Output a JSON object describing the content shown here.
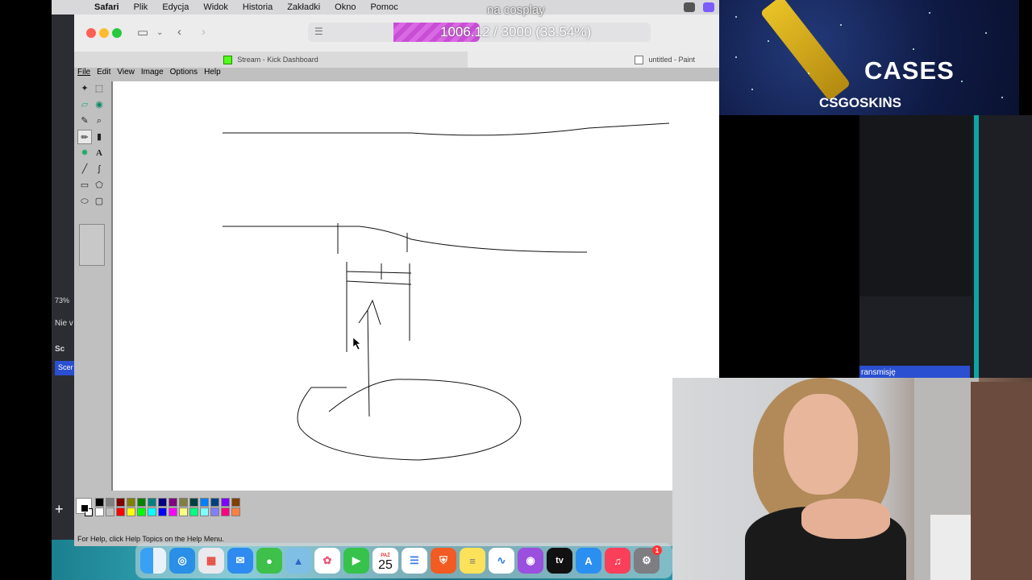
{
  "menubar": {
    "app": "Safari",
    "items": [
      "Plik",
      "Edycja",
      "Widok",
      "Historia",
      "Zakładki",
      "Okno",
      "Pomoc"
    ]
  },
  "overlay_caption": "na cosplay",
  "progress": {
    "text": "1006.12 / 3000 (33.54%)",
    "fraction": 0.3354
  },
  "tabs": [
    {
      "label": "Stream - Kick Dashboard",
      "icon": "kick-logo-icon"
    },
    {
      "label": "untitled - Paint",
      "icon": "paint-icon"
    }
  ],
  "paint": {
    "menu": [
      "File",
      "Edit",
      "View",
      "Image",
      "Options",
      "Help"
    ],
    "status": "For Help, click Help Topics on the Help Menu.",
    "palette": [
      "#000000",
      "#808080",
      "#800000",
      "#808000",
      "#008000",
      "#008080",
      "#000080",
      "#800080",
      "#808040",
      "#004040",
      "#0080ff",
      "#004080",
      "#8000ff",
      "#804000",
      "#ffffff",
      "#c0c0c0",
      "#ff0000",
      "#ffff00",
      "#00ff00",
      "#00ffff",
      "#0000ff",
      "#ff00ff",
      "#ffff80",
      "#00ff80",
      "#80ffff",
      "#8080ff",
      "#ff0080",
      "#ff8040"
    ]
  },
  "side": {
    "zoom": "73%",
    "label_nie": "Nie v",
    "label_sc": "Sc",
    "scene": "Scer"
  },
  "obs": {
    "button": "ransmisję"
  },
  "ad": {
    "headline": "CASES",
    "brand": "CSGOSKINS"
  },
  "dock": {
    "calendar_month": "PAŹ",
    "calendar_day": "25",
    "badge": "1",
    "apps": [
      "finder",
      "safari",
      "launchpad",
      "mail",
      "messages",
      "maps",
      "photos",
      "facetime",
      "calendar",
      "reminders",
      "brave",
      "notes",
      "freeform",
      "podcasts",
      "appletv",
      "appstore",
      "music",
      "settings"
    ]
  }
}
